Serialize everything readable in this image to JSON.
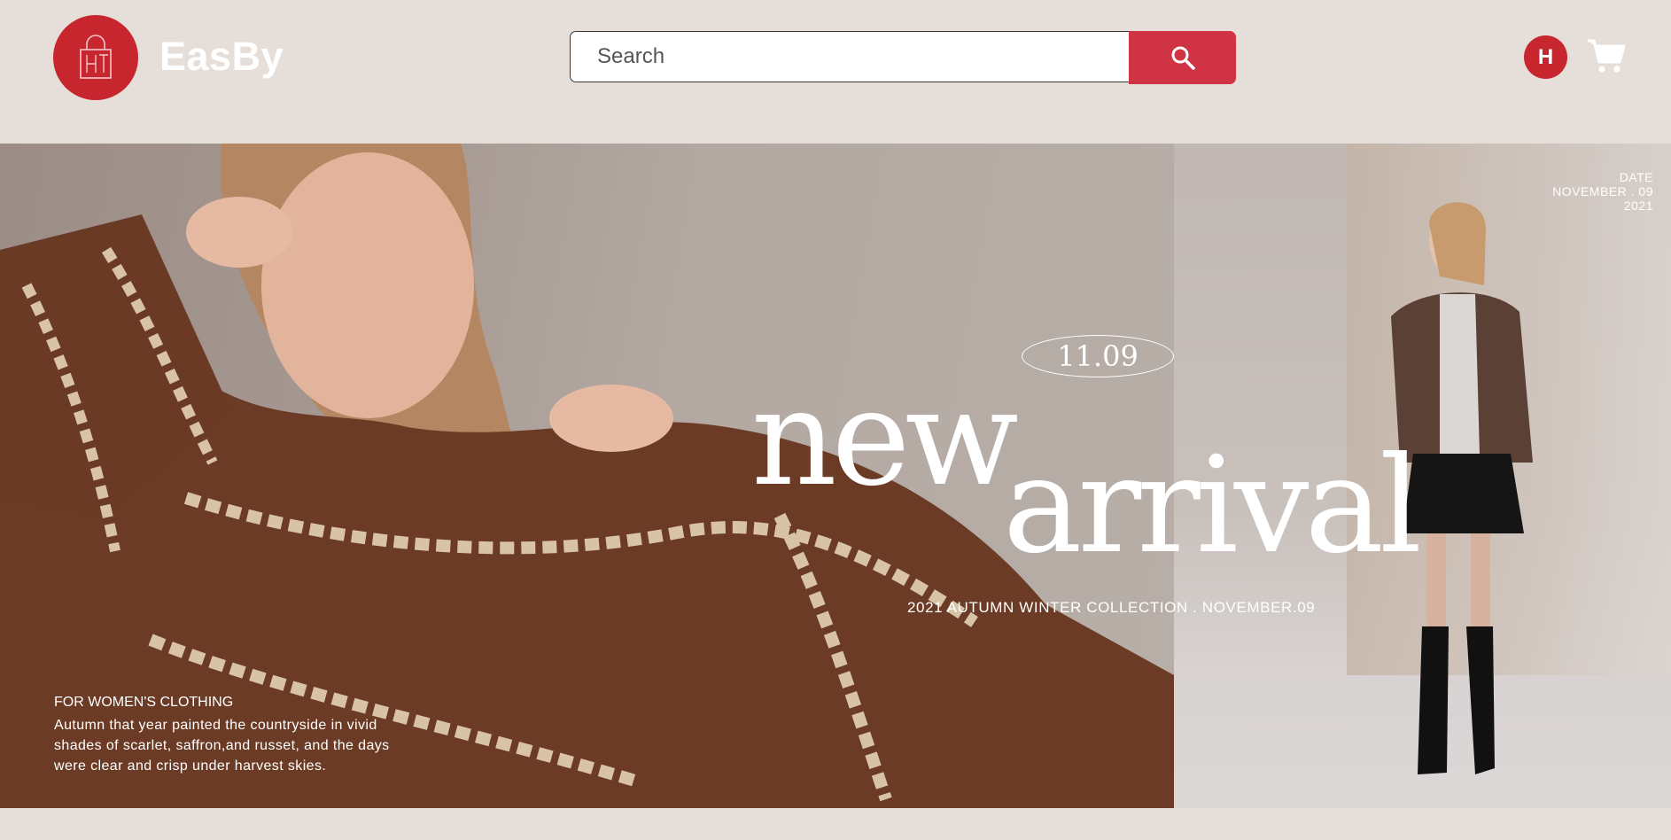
{
  "header": {
    "brand": "EasBy",
    "search": {
      "placeholder": "Search",
      "value": ""
    },
    "search_icon": "search-icon",
    "avatar_initial": "H",
    "cart_icon": "cart-icon",
    "logo_icon": "shopping-bag-icon"
  },
  "hero": {
    "date_label": "DATE",
    "date_value": "NOVEMBER . 09",
    "date_year": "2021",
    "badge": "11.09",
    "headline_1": "new",
    "headline_2": "arrival",
    "collection": "2021 AUTUMN WINTER COLLECTION . NOVEMBER.09",
    "category": "FOR WOMEN'S CLOTHING",
    "description": "Autumn that year painted the countryside in vivid shades of scarlet, saffron,and russet, and the days were clear and crisp under harvest skies."
  },
  "colors": {
    "accent": "#c8262f",
    "search_button": "#d03344",
    "header_bg": "#e6ded9"
  }
}
